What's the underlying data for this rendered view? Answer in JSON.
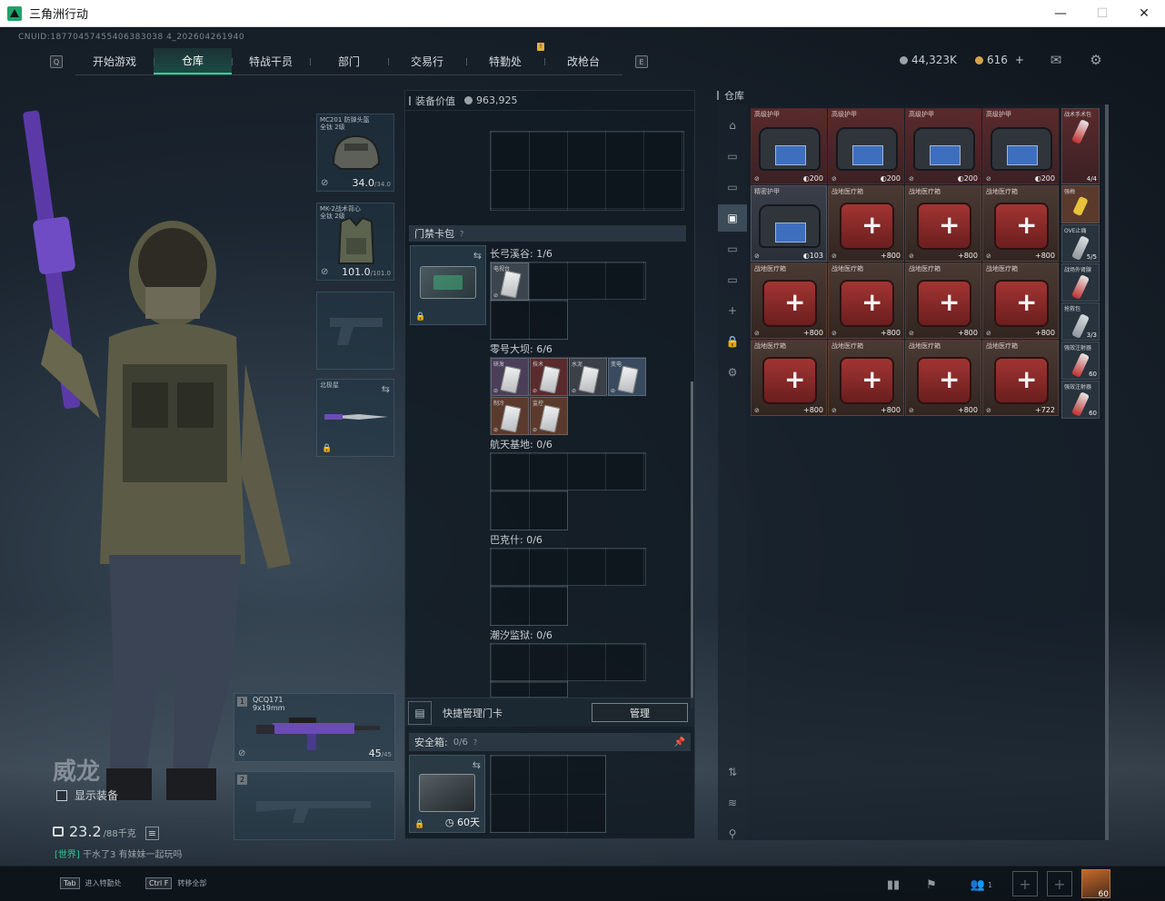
{
  "window": {
    "title": "三角洲行动",
    "controls": [
      "—",
      "☐",
      "✕"
    ]
  },
  "cnuid": "CNUID:18770457455406383038 4_202604261940",
  "nav": {
    "left_key": "Q",
    "right_key": "E",
    "tabs": [
      "开始游戏",
      "仓库",
      "特战干员",
      "部门",
      "交易行",
      "特勤处",
      "改枪台"
    ],
    "active_tab": "仓库",
    "alert_badge": "!"
  },
  "currency": {
    "coins": "44,323K",
    "tickets": "616",
    "add": "+"
  },
  "operator": {
    "name": "威龙",
    "show_gear_label": "显示装备",
    "weight": "23.2",
    "weight_cap": "/88千克",
    "chat_tag": "[世界]",
    "chat_text": "干水了3 有妹妹一起玩吗"
  },
  "gear": {
    "helmet": {
      "label": "MC201 防弹头盔",
      "sub": "全钛 2级",
      "dur": "34.0",
      "max": "/34.0"
    },
    "armor": {
      "label": "MK-2战术背心",
      "sub": "全钛 2级",
      "dur": "101.0",
      "max": "/101.0"
    },
    "melee": {
      "label": "北极星"
    },
    "primary": {
      "num": "1",
      "name": "QCQ171",
      "caliber": "9x19mm",
      "ammo": "45",
      "ammo_max": "/45"
    },
    "secondary": {
      "num": "2"
    }
  },
  "center": {
    "equip_value_label": "装备价值",
    "equip_value": "963,925",
    "card_section": "门禁卡包",
    "maps": [
      {
        "name": "长弓溪谷: 1/6"
      },
      {
        "name": "零号大坝: 6/6"
      },
      {
        "name": "航天基地: 0/6"
      },
      {
        "name": "巴克什: 0/6"
      },
      {
        "name": "潮汐监狱: 0/6"
      }
    ],
    "dam_cards": [
      "研发",
      "技术",
      "水泥",
      "变电",
      "制冷",
      "监控"
    ],
    "valley_card": "电视台",
    "quick_manage": "快捷管理门卡",
    "manage_btn": "管理",
    "safe_label": "安全箱:",
    "safe_count": "0/6",
    "safe_days": "60天"
  },
  "warehouse": {
    "title": "仓库",
    "armor_label": "高级护甲",
    "armor2_label": "精密护甲",
    "med_label": "战地医疗箱",
    "armor_values": [
      "200",
      "200",
      "200",
      "200",
      "103"
    ],
    "med_values": [
      "800",
      "800",
      "800",
      "800",
      "800",
      "800",
      "800",
      "800",
      "800",
      "800",
      "722"
    ],
    "narrow": [
      {
        "label": "战术手术包",
        "val": "4/4"
      },
      {
        "label": "强梅",
        "val": ""
      },
      {
        "label": "OVE止痛",
        "val": "5/5"
      },
      {
        "label": "战场外肾腺",
        "val": ""
      },
      {
        "label": "抢救包",
        "val": "3/3"
      },
      {
        "label": "强效注射器",
        "val": "60"
      },
      {
        "label": "强效注射器",
        "val": "60"
      }
    ]
  },
  "bottom": {
    "hint1_key": "Tab",
    "hint1": "进入特勤处",
    "hint2_key": "Ctrl F",
    "hint2": "转移全部",
    "friends": "1",
    "level": "60"
  },
  "colors": {
    "accent": "#2fd39d",
    "armor_red": "#5a2a2c",
    "med_red": "#a23533"
  }
}
